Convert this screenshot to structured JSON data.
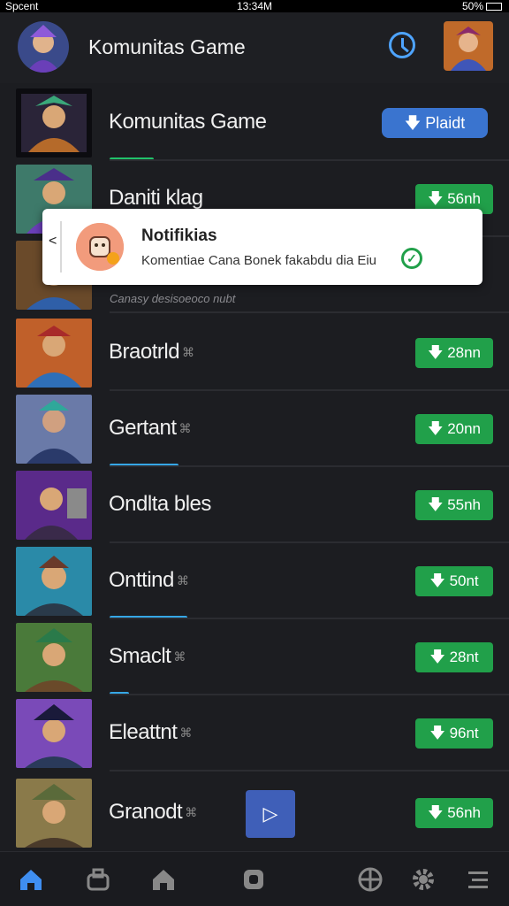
{
  "status_bar": {
    "carrier": "Spcent",
    "time": "13:34M",
    "battery": "50%"
  },
  "header": {
    "title": "Komunitas Game"
  },
  "rows": [
    {
      "name": "Komunitas Game",
      "button": "Plaidt",
      "button_style": "blue",
      "progress": 0.13,
      "progress_color": "#21c26a"
    },
    {
      "name": "Daniti klag",
      "button": "56nh",
      "button_style": "green"
    },
    {
      "name": "",
      "button": "",
      "button_style": "none"
    },
    {
      "name": "Braotrld",
      "button": "28nn",
      "button_style": "green"
    },
    {
      "name": "Gertant",
      "button": "20nn",
      "button_style": "green",
      "progress": 0.2,
      "progress_color": "#36a7e6"
    },
    {
      "name": "Ondlta bles",
      "button": "55nh",
      "button_style": "green"
    },
    {
      "name": "Onttind",
      "button": "50nt",
      "button_style": "green",
      "progress": 0.23,
      "progress_color": "#36a7e6"
    },
    {
      "name": "Smaclt",
      "button": "28nt",
      "button_style": "green",
      "progress": 0.06,
      "progress_color": "#36a7e6"
    },
    {
      "name": "Eleattnt",
      "button": "96nt",
      "button_style": "green"
    },
    {
      "name": "Granodt",
      "button": "56nh",
      "button_style": "green"
    }
  ],
  "notification": {
    "title": "Notifikias",
    "body": "Komentiae Cana Bonek fakabdu dia Eiu"
  },
  "sub_caption": "Canasy desisoeoco nubt",
  "colors": {
    "accent_blue": "#3a74cf",
    "accent_green": "#21a04a",
    "background": "#1c1d21"
  },
  "bottom_nav": [
    "home",
    "gamepad",
    "house",
    "shield",
    "crosshair",
    "gear",
    "menu"
  ]
}
